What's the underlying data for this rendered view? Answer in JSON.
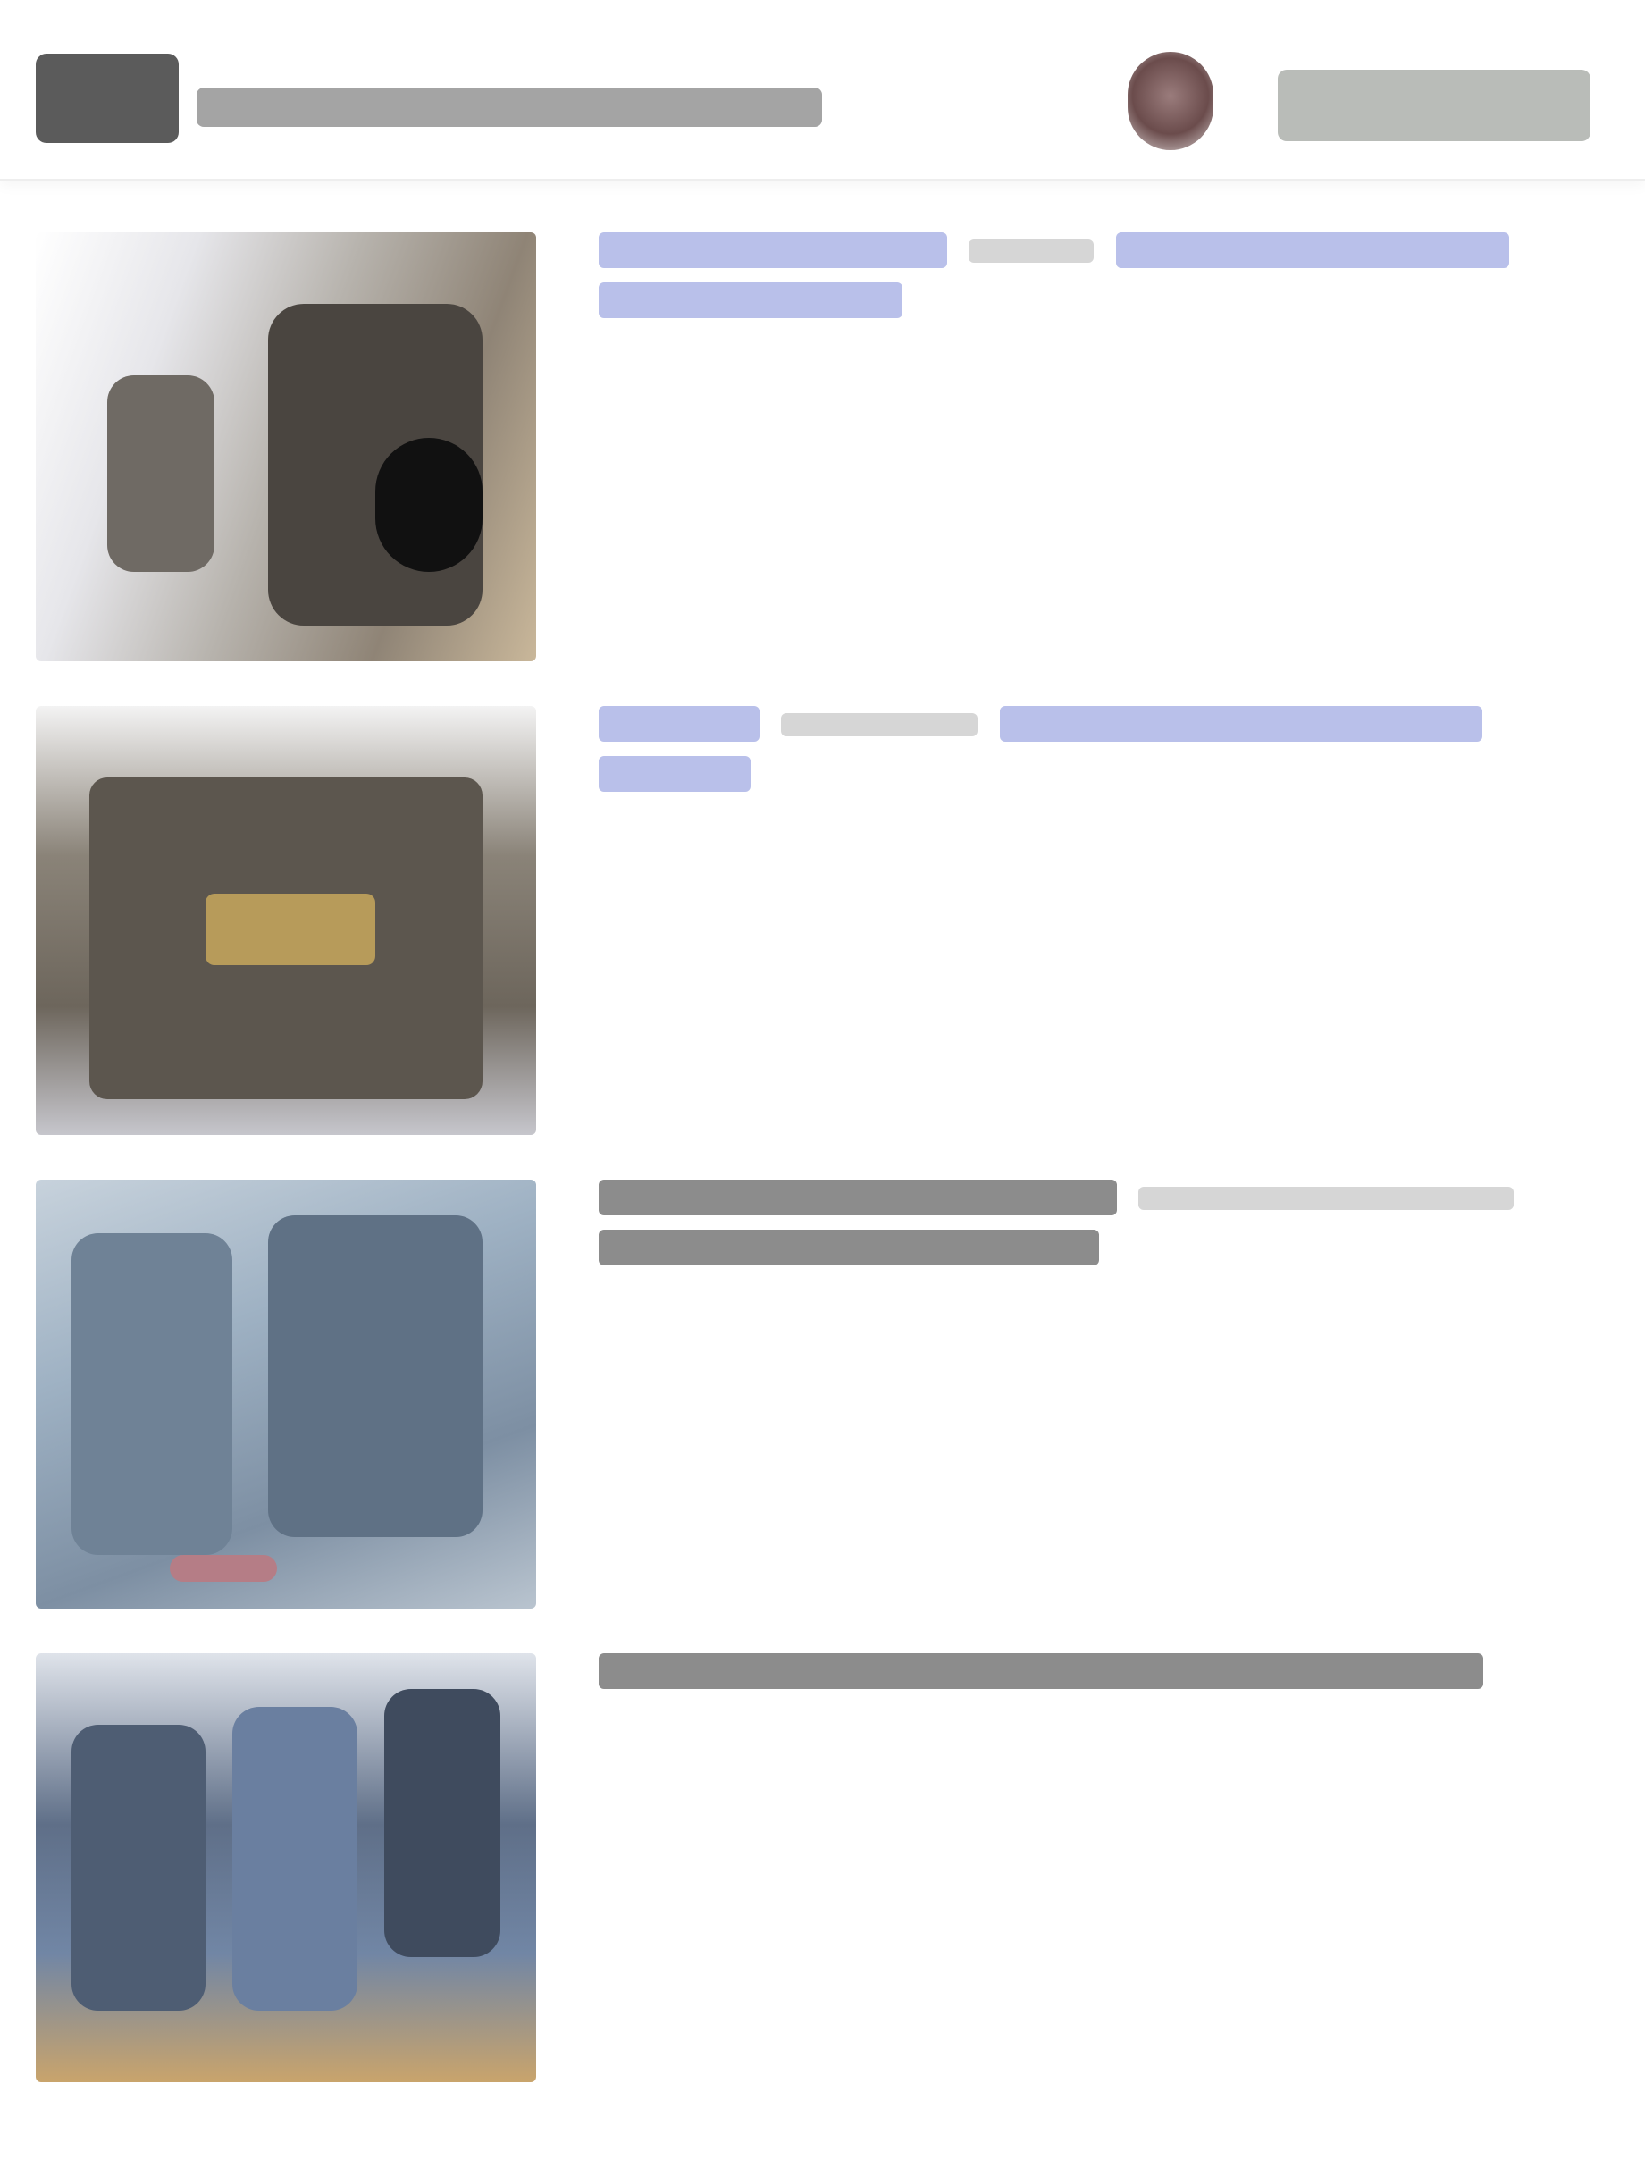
{
  "header": {
    "logo_icon": "site-logo",
    "title": "",
    "avatar_icon": "user-avatar",
    "action_label": ""
  },
  "items": [
    {
      "thumb_icon": "article-thumbnail",
      "link_label": "",
      "meta_label": "",
      "source_label": ""
    },
    {
      "thumb_icon": "article-thumbnail",
      "link_label": "",
      "meta_label": "",
      "source_label": ""
    },
    {
      "thumb_icon": "article-thumbnail",
      "title_label": "",
      "meta_label": ""
    },
    {
      "thumb_icon": "article-thumbnail",
      "title_label": ""
    }
  ],
  "colors": {
    "link": "#b9c0ea",
    "text_bar": "#8c8c8c",
    "button": "#b9bcb8"
  }
}
